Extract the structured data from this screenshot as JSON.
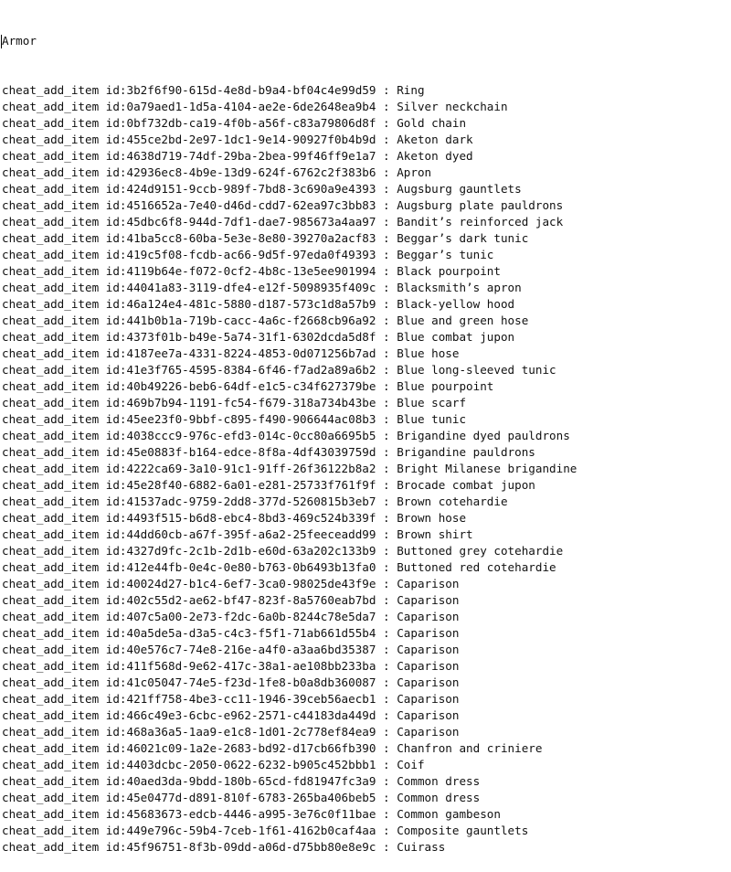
{
  "document": {
    "header": "Armor",
    "command": "cheat_add_item",
    "id_prefix": "id:",
    "separator": " : ",
    "items": [
      {
        "id": "3b2f6f90-615d-4e8d-b9a4-bf04c4e99d59",
        "name": "Ring"
      },
      {
        "id": "0a79aed1-1d5a-4104-ae2e-6de2648ea9b4",
        "name": "Silver neckchain"
      },
      {
        "id": "0bf732db-ca19-4f0b-a56f-c83a79806d8f",
        "name": "Gold chain"
      },
      {
        "id": "455ce2bd-2e97-1dc1-9e14-90927f0b4b9d",
        "name": "Aketon dark"
      },
      {
        "id": "4638d719-74df-29ba-2bea-99f46ff9e1a7",
        "name": "Aketon dyed"
      },
      {
        "id": "42936ec8-4b9e-13d9-624f-6762c2f383b6",
        "name": "Apron"
      },
      {
        "id": "424d9151-9ccb-989f-7bd8-3c690a9e4393",
        "name": "Augsburg gauntlets"
      },
      {
        "id": "4516652a-7e40-d46d-cdd7-62ea97c3bb83",
        "name": "Augsburg plate pauldrons"
      },
      {
        "id": "45dbc6f8-944d-7df1-dae7-985673a4aa97",
        "name": "Bandit’s reinforced jack"
      },
      {
        "id": "41ba5cc8-60ba-5e3e-8e80-39270a2acf83",
        "name": "Beggar’s dark tunic"
      },
      {
        "id": "419c5f08-fcdb-ac66-9d5f-97eda0f49393",
        "name": "Beggar’s tunic"
      },
      {
        "id": "4119b64e-f072-0cf2-4b8c-13e5ee901994",
        "name": "Black pourpoint"
      },
      {
        "id": "44041a83-3119-dfe4-e12f-5098935f409c",
        "name": "Blacksmith’s apron"
      },
      {
        "id": "46a124e4-481c-5880-d187-573c1d8a57b9",
        "name": "Black-yellow hood"
      },
      {
        "id": "441b0b1a-719b-cacc-4a6c-f2668cb96a92",
        "name": "Blue and green hose"
      },
      {
        "id": "4373f01b-b49e-5a74-31f1-6302dcda5d8f",
        "name": "Blue combat jupon"
      },
      {
        "id": "4187ee7a-4331-8224-4853-0d071256b7ad",
        "name": "Blue hose"
      },
      {
        "id": "41e3f765-4595-8384-6f46-f7ad2a89a6b2",
        "name": "Blue long-sleeved tunic"
      },
      {
        "id": "40b49226-beb6-64df-e1c5-c34f627379be",
        "name": "Blue pourpoint"
      },
      {
        "id": "469b7b94-1191-fc54-f679-318a734b43be",
        "name": "Blue scarf"
      },
      {
        "id": "45ee23f0-9bbf-c895-f490-906644ac08b3",
        "name": "Blue tunic"
      },
      {
        "id": "4038ccc9-976c-efd3-014c-0cc80a6695b5",
        "name": "Brigandine dyed pauldrons"
      },
      {
        "id": "45e0883f-b164-edce-8f8a-4df43039759d",
        "name": "Brigandine pauldrons"
      },
      {
        "id": "4222ca69-3a10-91c1-91ff-26f36122b8a2",
        "name": "Bright Milanese brigandine"
      },
      {
        "id": "45e28f40-6882-6a01-e281-25733f761f9f",
        "name": "Brocade combat jupon"
      },
      {
        "id": "41537adc-9759-2dd8-377d-5260815b3eb7",
        "name": "Brown cotehardie"
      },
      {
        "id": "4493f515-b6d8-ebc4-8bd3-469c524b339f",
        "name": "Brown hose"
      },
      {
        "id": "44dd60cb-a67f-395f-a6a2-25feeceadd99",
        "name": "Brown shirt"
      },
      {
        "id": "4327d9fc-2c1b-2d1b-e60d-63a202c133b9",
        "name": "Buttoned grey cotehardie"
      },
      {
        "id": "412e44fb-0e4c-0e80-b763-0b6493b13fa0",
        "name": "Buttoned red cotehardie"
      },
      {
        "id": "40024d27-b1c4-6ef7-3ca0-98025de43f9e",
        "name": "Caparison"
      },
      {
        "id": "402c55d2-ae62-bf47-823f-8a5760eab7bd",
        "name": "Caparison"
      },
      {
        "id": "407c5a00-2e73-f2dc-6a0b-8244c78e5da7",
        "name": "Caparison"
      },
      {
        "id": "40a5de5a-d3a5-c4c3-f5f1-71ab661d55b4",
        "name": "Caparison"
      },
      {
        "id": "40e576c7-74e8-216e-a4f0-a3aa6bd35387",
        "name": "Caparison"
      },
      {
        "id": "411f568d-9e62-417c-38a1-ae108bb233ba",
        "name": "Caparison"
      },
      {
        "id": "41c05047-74e5-f23d-1fe8-b0a8db360087",
        "name": "Caparison"
      },
      {
        "id": "421ff758-4be3-cc11-1946-39ceb56aecb1",
        "name": "Caparison"
      },
      {
        "id": "466c49e3-6cbc-e962-2571-c44183da449d",
        "name": "Caparison"
      },
      {
        "id": "468a36a5-1aa9-e1c8-1d01-2c778ef84ea9",
        "name": "Caparison"
      },
      {
        "id": "46021c09-1a2e-2683-bd92-d17cb66fb390",
        "name": "Chanfron and criniere"
      },
      {
        "id": "4403dcbc-2050-0622-6232-b905c452bbb1",
        "name": "Coif"
      },
      {
        "id": "40aed3da-9bdd-180b-65cd-fd81947fc3a9",
        "name": "Common dress"
      },
      {
        "id": "45e0477d-d891-810f-6783-265ba406beb5",
        "name": "Common dress"
      },
      {
        "id": "45683673-edcb-4446-a995-3e76c0f11bae",
        "name": "Common gambeson"
      },
      {
        "id": "449e796c-59b4-7ceb-1f61-4162b0caf4aa",
        "name": "Composite gauntlets"
      },
      {
        "id": "45f96751-8f3b-09dd-a06d-d75bb80e8e9c",
        "name": "Cuirass"
      }
    ]
  }
}
